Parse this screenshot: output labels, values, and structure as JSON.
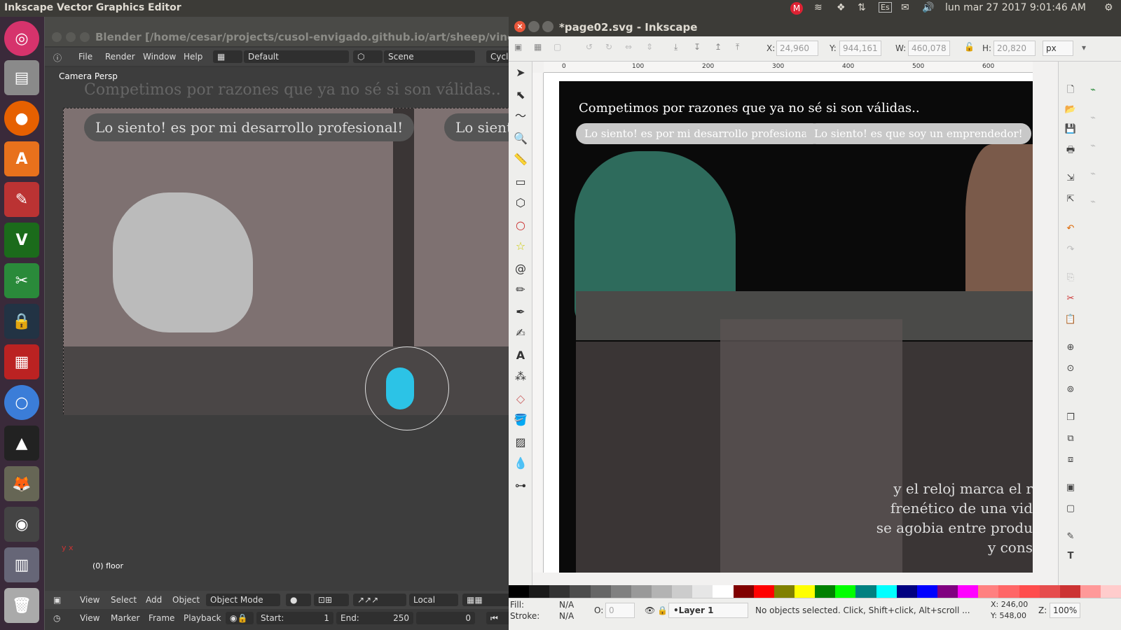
{
  "top_panel": {
    "app_title": "Inkscape Vector Graphics Editor",
    "clock": "lun mar 27 2017  9:01:46 AM",
    "keyboard": "Es"
  },
  "blender": {
    "title": "Blender [/home/cesar/projects/cusol-envigado.github.io/art/sheep/vineta_compe",
    "menu": [
      "File",
      "Render",
      "Window",
      "Help"
    ],
    "layout": "Default",
    "scene": "Scene",
    "engine": "Cycl",
    "viewport_label": "Camera Persp",
    "caption": "Competimos por razones que ya no sé si son válidas..",
    "bubble1": "Lo siento! es por mi desarrollo profesional!",
    "bubble2": "Lo sient",
    "object_label": "(0) floor",
    "bottom_menu": [
      "View",
      "Select",
      "Add",
      "Object"
    ],
    "mode": "Object Mode",
    "orientation": "Local",
    "timeline_menu": [
      "View",
      "Marker",
      "Frame",
      "Playback"
    ],
    "start_label": "Start:",
    "start_value": "1",
    "end_label": "End:",
    "end_value": "250",
    "current_frame": "0"
  },
  "inkscape": {
    "title": "*page02.svg - Inkscape",
    "x_label": "X:",
    "x_value": "24,960",
    "y_label": "Y:",
    "y_value": "944,161",
    "w_label": "W:",
    "w_value": "460,078",
    "h_label": "H:",
    "h_value": "20,820",
    "unit": "px",
    "ruler_ticks": [
      "0",
      "100",
      "200",
      "300",
      "400",
      "500",
      "600"
    ],
    "caption": "Competimos por razones que ya no sé si son válidas..",
    "bubble1": "Lo siento! es por mi desarrollo profesional!",
    "bubble2": "Lo siento! es que soy un emprendedor!",
    "story_lines": [
      "y el reloj marca el r",
      "frenético de una vid",
      "se agobia entre produ",
      "y cons"
    ],
    "fill_label": "Fill:",
    "fill_value": "N/A",
    "stroke_label": "Stroke:",
    "stroke_value": "N/A",
    "opacity_label": "O:",
    "opacity_value": "0",
    "layer": "•Layer 1",
    "status_message": "No objects selected. Click, Shift+click, Alt+scroll ...",
    "cursor_x": "X: 246,00",
    "cursor_y": "Y: 548,00",
    "zoom_label": "Z:",
    "zoom_value": "100%"
  },
  "colors": {
    "ubuntu_orange": "#e9563a",
    "palette": [
      "#000000",
      "#1a1a1a",
      "#333333",
      "#4d4d4d",
      "#666666",
      "#808080",
      "#999999",
      "#b3b3b3",
      "#cccccc",
      "#e6e6e6",
      "#ffffff",
      "#800000",
      "#ff0000",
      "#808000",
      "#ffff00",
      "#008000",
      "#00ff00",
      "#008080",
      "#00ffff",
      "#000080",
      "#0000ff",
      "#800080",
      "#ff00ff",
      "#ff8080",
      "#ff6666",
      "#ff4d4d",
      "#e64d4d",
      "#cc3333",
      "#ff9999",
      "#ffcccc"
    ]
  }
}
